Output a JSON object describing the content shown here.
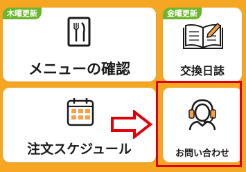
{
  "menu": {
    "confirm": {
      "badge": "木曜更新",
      "label": "メニューの確認",
      "icon": "menu-utensils-icon"
    },
    "diary": {
      "badge": "金曜更新",
      "label": "交換日誌",
      "icon": "open-book-pen-icon"
    },
    "schedule": {
      "label": "注文スケジュール",
      "icon": "calendar-icon"
    },
    "contact": {
      "label": "お問い合わせ",
      "icon": "headset-support-icon"
    }
  },
  "colors": {
    "background": "#f5a623",
    "card": "#ffffff",
    "badge": "#6ab62e",
    "highlight": "#e0000b",
    "calendar_cells": "#f7a24a"
  },
  "annotation": {
    "arrow": "right-arrow-icon",
    "frame": "red-highlight-box"
  }
}
